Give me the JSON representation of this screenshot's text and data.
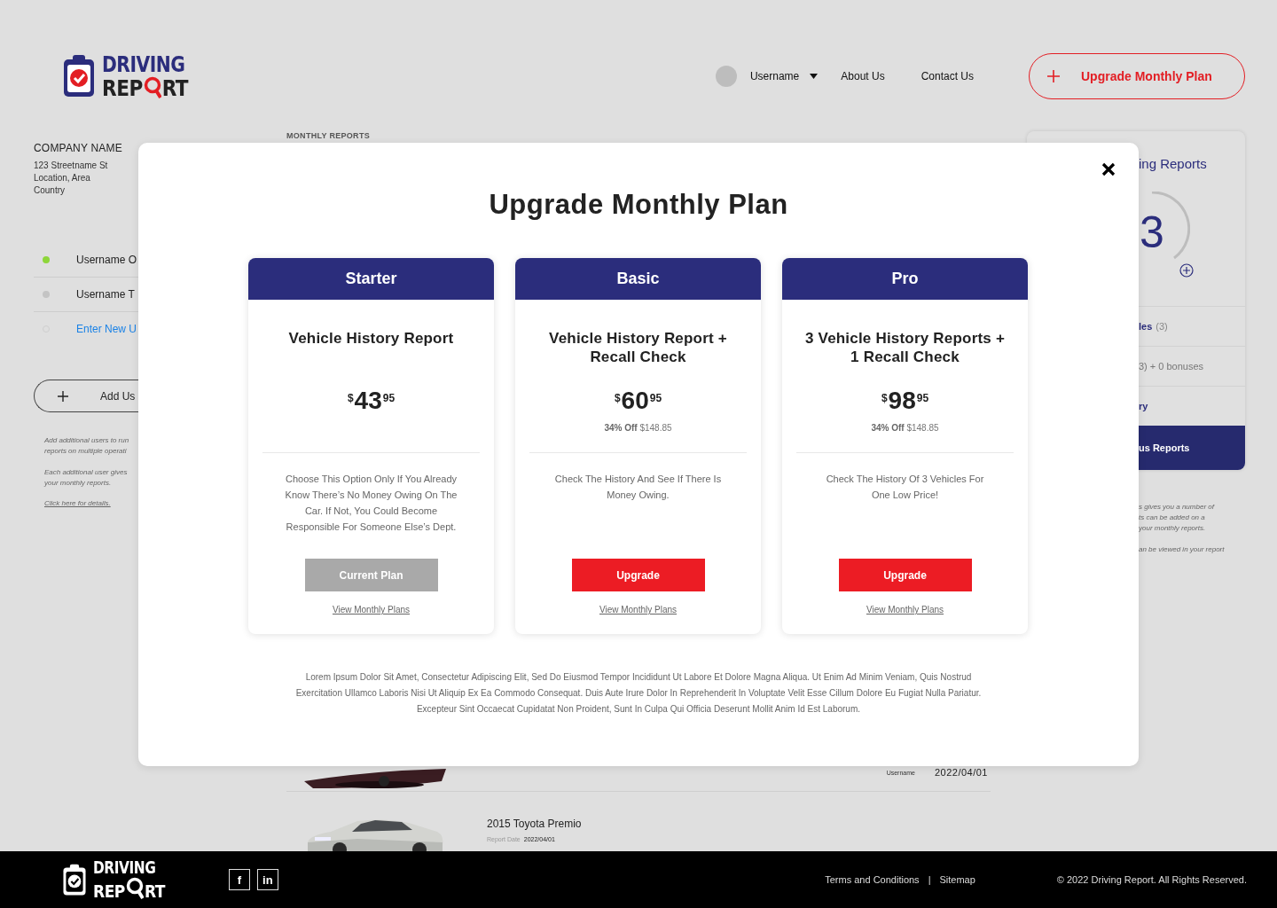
{
  "header": {
    "logo": {
      "top": "DRIVING",
      "bottom_left": "REP",
      "bottom_right": "RT"
    },
    "user": {
      "name": "Username"
    },
    "links": [
      "About Us",
      "Contact Us"
    ],
    "upgrade_button": "Upgrade Monthly Plan"
  },
  "sidebar": {
    "company_name": "COMPANY NAME",
    "address": [
      "123 Streetname St",
      "Location, Area",
      "Country"
    ],
    "users": [
      {
        "name": "Username O",
        "kind": "user",
        "color": "#8ed63a"
      },
      {
        "name": "Username T",
        "kind": "user",
        "color": "#c4c4c4"
      },
      {
        "name": "Enter New U",
        "kind": "new",
        "color": "#cfcfcf"
      }
    ],
    "add_button": "Add Us",
    "notes": [
      [
        "Add additional users to run",
        "reports on multiple operati"
      ],
      [
        "Each additional user gives",
        "your monthly reports."
      ]
    ],
    "details_link": "Click here for details."
  },
  "reports": {
    "title": "MONTHLY REPORTS",
    "rows": [
      {
        "kind": "partial",
        "user": "Username",
        "date": "2022/04/01"
      },
      {
        "kind": "full",
        "title": "2015 Toyota Premio",
        "date_label": "Report Date",
        "date": "2022/04/01"
      }
    ]
  },
  "summary": {
    "title": "ing Reports",
    "count": "3",
    "rows": [
      {
        "kind": "vehicles",
        "label": "les",
        "count": "(3)"
      },
      {
        "kind": "plain",
        "label": "3) + 0 bonuses"
      },
      {
        "kind": "link",
        "label": "ry"
      }
    ],
    "bonus_button": "us Reports",
    "notes": [
      [
        "s gives you a number of",
        "ts can be added on a",
        "your monthly reports."
      ],
      [
        "an be viewed in your report"
      ]
    ]
  },
  "modal": {
    "title": "Upgrade Monthly Plan",
    "plans": [
      {
        "name": "Starter",
        "title": "Vehicle History Report",
        "currency": "$",
        "dollars": "43",
        "cents": "95",
        "description": "Choose This Option Only If You Already Know There’s No Money Owing On The Car. If Not, You Could Become Responsible For Someone Else’s Dept.",
        "button": {
          "label": "Current Plan",
          "kind": "current"
        },
        "link": "View Monthly Plans"
      },
      {
        "name": "Basic",
        "title": "Vehicle History Report + Recall Check",
        "currency": "$",
        "dollars": "60",
        "cents": "95",
        "discount": {
          "percent": "34% Off",
          "original": "$148.85"
        },
        "description": "Check The History And See If There Is Money Owing.",
        "button": {
          "label": "Upgrade",
          "kind": "upgrade"
        },
        "link": "View Monthly Plans"
      },
      {
        "name": "Pro",
        "title": "3 Vehicle History Reports + 1 Recall Check",
        "currency": "$",
        "dollars": "98",
        "cents": "95",
        "discount": {
          "percent": "34% Off",
          "original": "$148.85"
        },
        "description": "Check The History Of 3 Vehicles For One Low Price!",
        "button": {
          "label": "Upgrade",
          "kind": "upgrade"
        },
        "link": "View Monthly Plans"
      }
    ],
    "disclaimer": "Lorem Ipsum Dolor Sit Amet, Consectetur Adipiscing Elit, Sed Do Eiusmod Tempor Incididunt Ut Labore Et Dolore Magna Aliqua. Ut Enim Ad Minim Veniam, Quis Nostrud Exercitation Ullamco Laboris Nisi Ut Aliquip Ex Ea Commodo Consequat. Duis Aute Irure Dolor In Reprehenderit In Voluptate Velit Esse Cillum Dolore Eu Fugiat Nulla Pariatur. Excepteur Sint Occaecat Cupidatat Non Proident, Sunt In Culpa Qui Officia Deserunt Mollit Anim Id Est Laborum."
  },
  "footer": {
    "logo": {
      "top": "DRIVING",
      "bottom_left": "REP",
      "bottom_right": "RT"
    },
    "social": [
      "f",
      "in"
    ],
    "links": [
      "Terms and Conditions",
      "Sitemap"
    ],
    "separator": "|",
    "copyright": "© 2022 Driving Report. All Rights Reserved."
  }
}
